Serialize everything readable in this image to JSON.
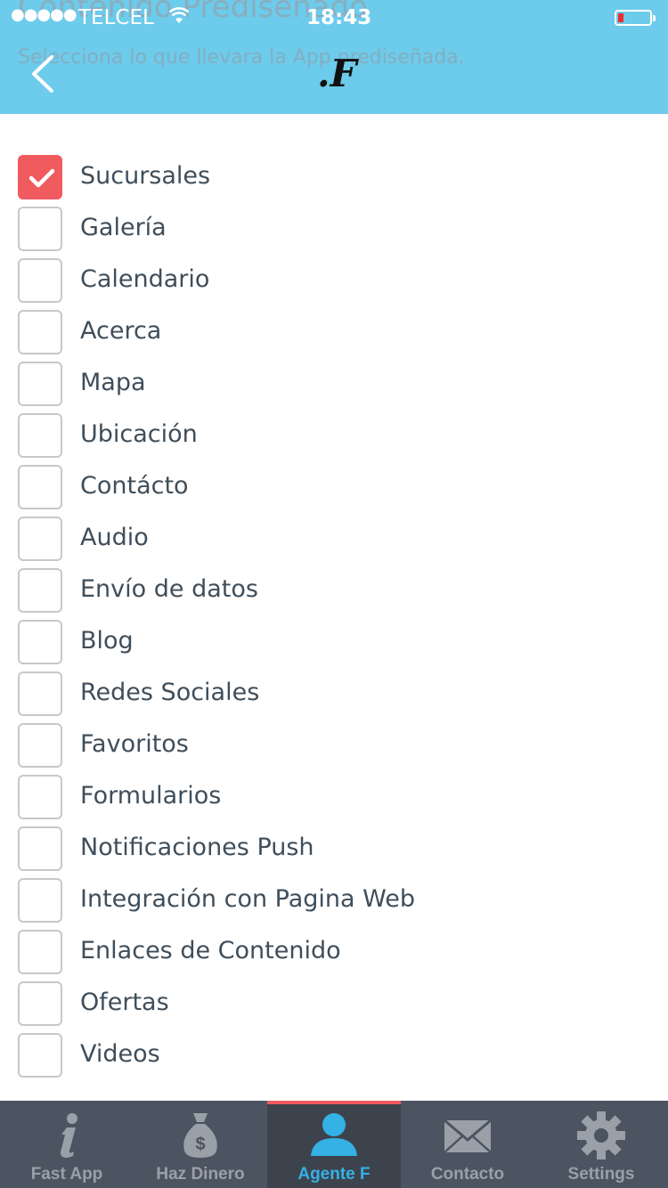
{
  "status_bar": {
    "signal": "●●●●●",
    "carrier": "TELCEL",
    "time": "18:43"
  },
  "header": {
    "ghost_title": "Contenido Prediseñado",
    "ghost_subtitle": "Selecciona lo que llevara la App prediseñada.",
    "logo": ".F"
  },
  "items": [
    {
      "label": "Sucursales",
      "checked": true
    },
    {
      "label": "Galería",
      "checked": false
    },
    {
      "label": "Calendario",
      "checked": false
    },
    {
      "label": "Acerca",
      "checked": false
    },
    {
      "label": "Mapa",
      "checked": false
    },
    {
      "label": "Ubicación",
      "checked": false
    },
    {
      "label": "Contácto",
      "checked": false
    },
    {
      "label": "Audio",
      "checked": false
    },
    {
      "label": "Envío de datos",
      "checked": false
    },
    {
      "label": "Blog",
      "checked": false
    },
    {
      "label": "Redes Sociales",
      "checked": false
    },
    {
      "label": "Favoritos",
      "checked": false
    },
    {
      "label": "Formularios",
      "checked": false
    },
    {
      "label": "Notificaciones Push",
      "checked": false
    },
    {
      "label": "Integración con Pagina Web",
      "checked": false
    },
    {
      "label": "Enlaces de Contenido",
      "checked": false
    },
    {
      "label": "Ofertas",
      "checked": false
    },
    {
      "label": "Videos",
      "checked": false
    }
  ],
  "tabs": [
    {
      "label": "Fast App",
      "icon": "info-icon",
      "active": false
    },
    {
      "label": "Haz Dinero",
      "icon": "money-bag-icon",
      "active": false
    },
    {
      "label": "Agente F",
      "icon": "user-icon",
      "active": true
    },
    {
      "label": "Contacto",
      "icon": "envelope-icon",
      "active": false
    },
    {
      "label": "Settings",
      "icon": "gear-icon",
      "active": false
    }
  ],
  "colors": {
    "header_bg": "#6dcbeb",
    "accent": "#ef5b5f",
    "tab_active_text": "#34b1e5",
    "tabbar_bg": "#4c5461"
  }
}
